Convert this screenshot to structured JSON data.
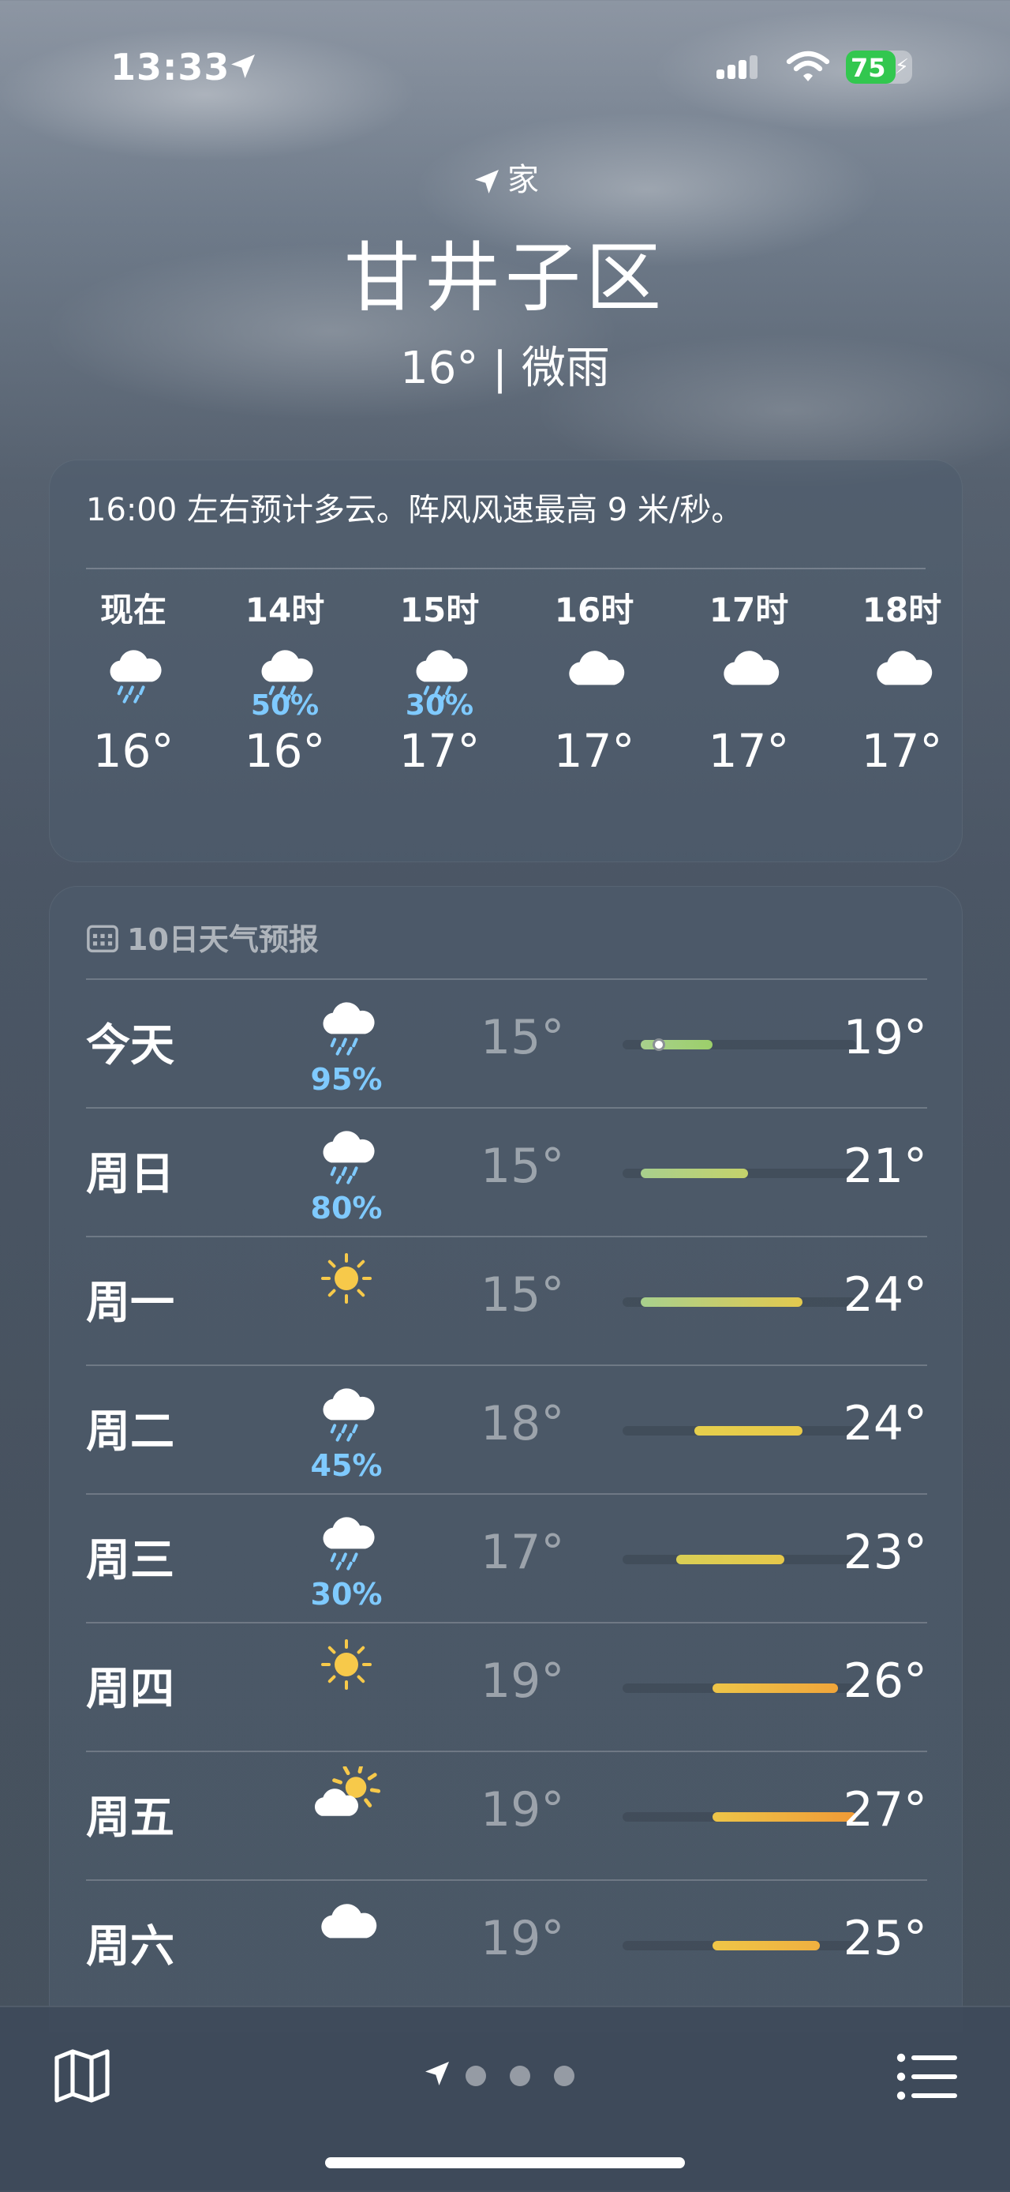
{
  "status_bar": {
    "time": "13:33",
    "battery": "75",
    "battery_level": 0.75
  },
  "header": {
    "location_label": "家",
    "city": "甘井子区",
    "condition": "16° | 微雨"
  },
  "hourly": {
    "summary": "16:00 左右预计多云。阵风风速最高 9 米/秒。",
    "hours": [
      {
        "label": "现在",
        "icon": "cloud-drizzle-icon",
        "pop": "",
        "temp": "16°"
      },
      {
        "label": "14时",
        "icon": "cloud-rain-icon",
        "pop": "50%",
        "temp": "16°"
      },
      {
        "label": "15时",
        "icon": "cloud-rain-icon",
        "pop": "30%",
        "temp": "17°"
      },
      {
        "label": "16时",
        "icon": "cloud-icon",
        "pop": "",
        "temp": "17°"
      },
      {
        "label": "17时",
        "icon": "cloud-icon",
        "pop": "",
        "temp": "17°"
      },
      {
        "label": "18时",
        "icon": "cloud-icon",
        "pop": "",
        "temp": "17°"
      }
    ]
  },
  "daily": {
    "title": "10日天气预报",
    "scale_min": 14,
    "scale_max": 27,
    "days": [
      {
        "name": "今天",
        "icon": "cloud-rain-icon",
        "pop": "95%",
        "low": "15°",
        "high": "19°",
        "low_val": 15,
        "high_val": 19,
        "current": 16,
        "bar_colors": [
          "#a8d08d",
          "#9ccf6a"
        ]
      },
      {
        "name": "周日",
        "icon": "cloud-rain-icon",
        "pop": "80%",
        "low": "15°",
        "high": "21°",
        "low_val": 15,
        "high_val": 21,
        "bar_colors": [
          "#a8d08d",
          "#c5d26b"
        ]
      },
      {
        "name": "周一",
        "icon": "sun-icon",
        "pop": "",
        "low": "15°",
        "high": "24°",
        "low_val": 15,
        "high_val": 24,
        "bar_colors": [
          "#a8d08d",
          "#e3c94e"
        ]
      },
      {
        "name": "周二",
        "icon": "cloud-rain-icon",
        "pop": "45%",
        "low": "18°",
        "high": "24°",
        "low_val": 18,
        "high_val": 24,
        "bar_colors": [
          "#e6cf4d",
          "#e9c948"
        ]
      },
      {
        "name": "周三",
        "icon": "cloud-rain-icon",
        "pop": "30%",
        "low": "17°",
        "high": "23°",
        "low_val": 17,
        "high_val": 23,
        "bar_colors": [
          "#d9cf55",
          "#e6c84a"
        ]
      },
      {
        "name": "周四",
        "icon": "sun-icon",
        "pop": "",
        "low": "19°",
        "high": "26°",
        "low_val": 19,
        "high_val": 26,
        "bar_colors": [
          "#eec548",
          "#f0a53a"
        ]
      },
      {
        "name": "周五",
        "icon": "partly-sunny-icon",
        "pop": "",
        "low": "19°",
        "high": "27°",
        "low_val": 19,
        "high_val": 27,
        "bar_colors": [
          "#eec548",
          "#f09a36"
        ]
      },
      {
        "name": "周六",
        "icon": "cloud-icon",
        "pop": "",
        "low": "19°",
        "high": "25°",
        "low_val": 19,
        "high_val": 25,
        "bar_colors": [
          "#f0c647",
          "#f0b040"
        ]
      }
    ]
  },
  "bottom_bar": {
    "page_count": 3
  }
}
